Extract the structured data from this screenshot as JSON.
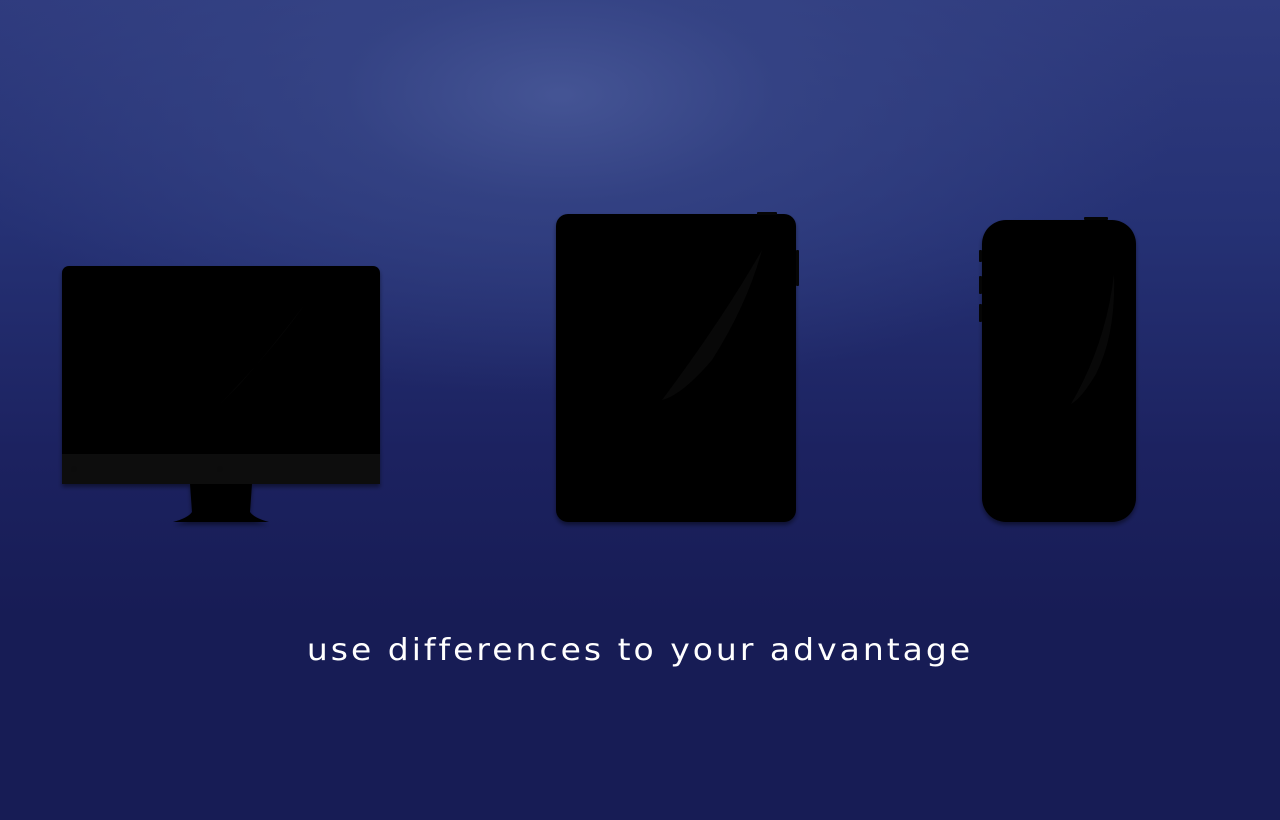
{
  "scene": {
    "devices": [
      {
        "kind": "desktop-monitor",
        "icon": "monitor-icon"
      },
      {
        "kind": "tablet",
        "icon": "tablet-icon"
      },
      {
        "kind": "phone",
        "icon": "phone-icon"
      }
    ],
    "tagline": "use differences to your advantage",
    "colors": {
      "background_top": "#3a4887",
      "background_bottom": "#171c55",
      "device_fill": "#050505",
      "text": "#ffffff"
    }
  }
}
